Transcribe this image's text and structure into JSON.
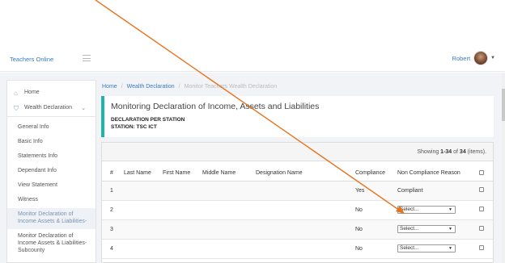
{
  "header": {
    "brand": "Teachers Online",
    "user_name": "Robert"
  },
  "sidebar": {
    "items": [
      {
        "label": "Home",
        "icon": "home-icon"
      },
      {
        "label": "Wealth Declaration",
        "icon": "shield-icon"
      }
    ],
    "submenu": [
      {
        "label": "General Info"
      },
      {
        "label": "Basic Info"
      },
      {
        "label": "Statements Info"
      },
      {
        "label": "Dependant Info"
      },
      {
        "label": "View Statement"
      },
      {
        "label": "Witness"
      },
      {
        "label_line1": "Monitor Declaration of",
        "label_line2": "Income Assets & Liabilities-"
      },
      {
        "label_line1": "Monitor Declaration of",
        "label_line2": "Income Assets & Liabilities-",
        "label_line3": "Subcounty"
      }
    ]
  },
  "breadcrumb": {
    "home": "Home",
    "section": "Wealth Declaration",
    "current": "Monitor Teachers Wealth Declaration"
  },
  "page": {
    "title": "Monitoring Declaration of Income, Assets and Liabilities",
    "line1": "DECLARATION PER STATION",
    "line2": "STATION: TSC ICT"
  },
  "summary": {
    "prefix": "Showing ",
    "range": "1-34",
    "mid": " of ",
    "total": "34",
    "suffix": " (items)."
  },
  "table": {
    "headers": [
      "#",
      "Last Name",
      "First Name",
      "Middle Name",
      "Designation Name",
      "Compliance",
      "Non Compliance Reason"
    ],
    "rows": [
      {
        "num": "1",
        "compliance": "Yes",
        "reason": "Compliant"
      },
      {
        "num": "2",
        "compliance": "No",
        "select": "Select..."
      },
      {
        "num": "3",
        "compliance": "No",
        "select": "Select..."
      },
      {
        "num": "4",
        "compliance": "No",
        "select": "Select..."
      }
    ]
  },
  "colors": {
    "accent": "#1fb5ac",
    "link": "#3a7bbf",
    "annotation_arrow": "#e8711c"
  }
}
